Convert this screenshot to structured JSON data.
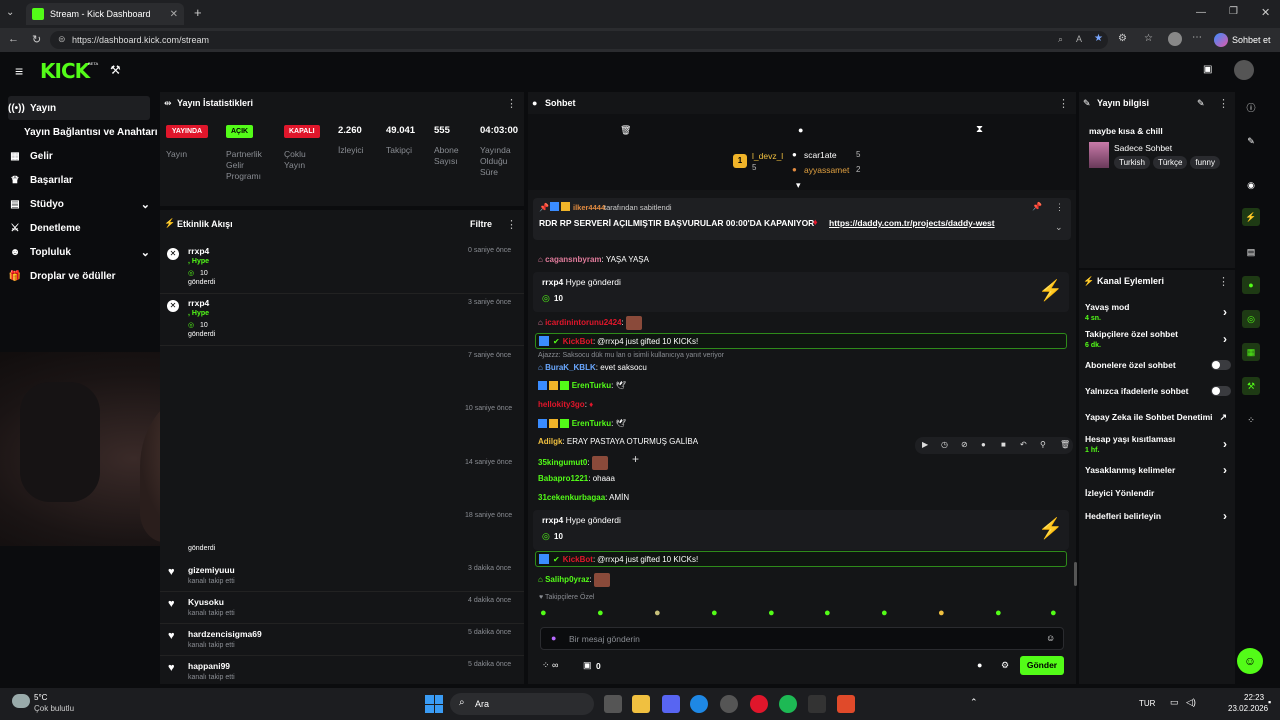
{
  "browser": {
    "tab_title": "Stream - Kick Dashboard",
    "url": "https://dashboard.kick.com/stream",
    "copilot_label": "Sohbet et"
  },
  "app": {
    "logo": "KICK",
    "beta": "BETA"
  },
  "sidebar": {
    "items": [
      {
        "label": "Yayın",
        "icon": "broadcast-icon"
      },
      {
        "label": "Yayın Bağlantısı ve Anahtarı"
      },
      {
        "label": "Gelir",
        "icon": "money-icon"
      },
      {
        "label": "Başarılar",
        "icon": "trophy-icon"
      },
      {
        "label": "Stüdyo",
        "icon": "studio-icon"
      },
      {
        "label": "Denetleme",
        "icon": "sword-icon"
      },
      {
        "label": "Topluluk",
        "icon": "community-icon"
      },
      {
        "label": "Droplar ve ödüller",
        "icon": "gift-icon"
      }
    ]
  },
  "stats": {
    "title": "Yayın İstatistikleri",
    "badges": [
      {
        "text": "YAYINDA",
        "label": "Yayın",
        "color": "#e0162b"
      },
      {
        "text": "AÇIK",
        "label": "Partnerlik Gelir Programı",
        "color": "#53fc18"
      },
      {
        "text": "KAPALI",
        "label": "Çoklu Yayın",
        "color": "#e0162b"
      }
    ],
    "metrics": [
      {
        "value": "2.260",
        "label": "İzleyici"
      },
      {
        "value": "49.041",
        "label": "Takipçi"
      },
      {
        "value": "555",
        "label": "Abone Sayısı"
      },
      {
        "value": "04:03:00",
        "label": "Yayında Olduğu Süre"
      }
    ]
  },
  "activity": {
    "title": "Etkinlik Akışı",
    "filter": "Filtre",
    "events": [
      {
        "user": "rrxp4",
        "line2": ", Hype",
        "amount": "10",
        "line3": "gönderdi",
        "time": "0 saniye önce"
      },
      {
        "user": "rrxp4",
        "line2": ", Hype",
        "amount": "10",
        "line3": "gönderdi",
        "time": "3 saniye önce"
      },
      {
        "time": "7 saniye önce"
      },
      {
        "time": "10 saniye önce"
      },
      {
        "time": "14 saniye önce"
      },
      {
        "time": "18 saniye önce",
        "line3": "gönderdi"
      },
      {
        "user": "gizemiyuuu",
        "line2": "kanalı takip etti",
        "time": "3 dakika önce"
      },
      {
        "user": "Kyusoku",
        "line2": "kanalı takip etti",
        "time": "4 dakika önce"
      },
      {
        "user": "hardzencisigma69",
        "line2": "kanalı takip etti",
        "time": "5 dakika önce"
      },
      {
        "user": "happani99",
        "line2": "kanalı takip etti",
        "time": "5 dakika önce"
      }
    ]
  },
  "chat": {
    "title": "Sohbet",
    "leaders": [
      {
        "name": "l_devz_l",
        "count": "5"
      },
      {
        "name": "scar1ate",
        "count": "5"
      },
      {
        "name": "ayyassamet",
        "count": "2"
      }
    ],
    "pinned": {
      "by": "ilker4444",
      "by_suffix": "tarafından sabitlendi",
      "text": "RDR RP SERVERİ AÇILMIŞTIR BAŞVURULAR 00:00'DA KAPANIYOR",
      "link": "https://daddy.com.tr/projects/daddy-west"
    },
    "messages": [
      {
        "user": "cagansnbyram",
        "text": "YAŞA YAŞA",
        "color": "#e07b9b"
      },
      {
        "user": "icardinintorunu2424",
        "text": "",
        "color": "#e0162b"
      },
      {
        "user": "BuraK_KBLK",
        "text": "evet saksocu",
        "color": "#6aa8ff",
        "reply": "Ajazzz: Saksocu dük mu lan o isimli kullanıcıya yanıt veriyor"
      },
      {
        "user": "ErenTurku",
        "text": "",
        "color": "#53fc18"
      },
      {
        "user": "hellokity3go",
        "text": "",
        "color": "#e0162b"
      },
      {
        "user": "ErenTurku",
        "text": "",
        "color": "#53fc18"
      },
      {
        "user": "Adilgk",
        "text": "ERAY PASTAYA OTURMUŞ GALİBA",
        "color": "#f0c040"
      },
      {
        "user": "35kingumut0",
        "text": "",
        "color": "#53fc18"
      },
      {
        "user": "Babapro1221",
        "text": "ohaaa",
        "color": "#53fc18"
      },
      {
        "user": "31cekenkurbagaa",
        "text": "AMİN",
        "color": "#53fc18"
      },
      {
        "user": "Salihp0yraz",
        "text": "",
        "color": "#53fc18"
      }
    ],
    "hype": [
      {
        "user": "rrxp4",
        "text": "Hype gönderdi",
        "amount": "10"
      },
      {
        "user": "rrxp4",
        "text": "Hype gönderdi",
        "amount": "10"
      }
    ],
    "gifts": [
      {
        "user": "KickBot",
        "text": "@rrxp4 just gifted 10 KICKs!"
      },
      {
        "user": "KickBot",
        "text": "@rrxp4 just gifted 10 KICKs!"
      }
    ],
    "followers_only": "Takipçilere Özel",
    "placeholder": "Bir mesaj gönderin",
    "send": "Gönder",
    "count": "0"
  },
  "streaminfo": {
    "title": "Yayın bilgisi",
    "stream_title": "maybe kısa & chill",
    "category": "Sadece Sohbet",
    "tags": [
      "Turkish",
      "Türkçe",
      "funny"
    ]
  },
  "actions": {
    "title": "Kanal Eylemleri",
    "items": [
      {
        "label": "Yavaş mod",
        "sub": "4 sn."
      },
      {
        "label": "Takipçilere özel sohbet",
        "sub": "6 dk."
      },
      {
        "label": "Abonelere özel sohbet"
      },
      {
        "label": "Yalnızca ifadelerle sohbet"
      },
      {
        "label": "Yapay Zeka ile Sohbet Denetimi"
      },
      {
        "label": "Hesap yaşı kısıtlaması",
        "sub": "1 hf."
      },
      {
        "label": "Yasaklanmış kelimeler"
      },
      {
        "label": "İzleyici Yönlendir"
      },
      {
        "label": "Hedefleri belirleyin"
      }
    ]
  },
  "taskbar": {
    "temp": "5°C",
    "weather": "Çok bulutlu",
    "search": "Ara",
    "lang": "TUR",
    "time": "22:23",
    "date": "23.02.2026"
  }
}
